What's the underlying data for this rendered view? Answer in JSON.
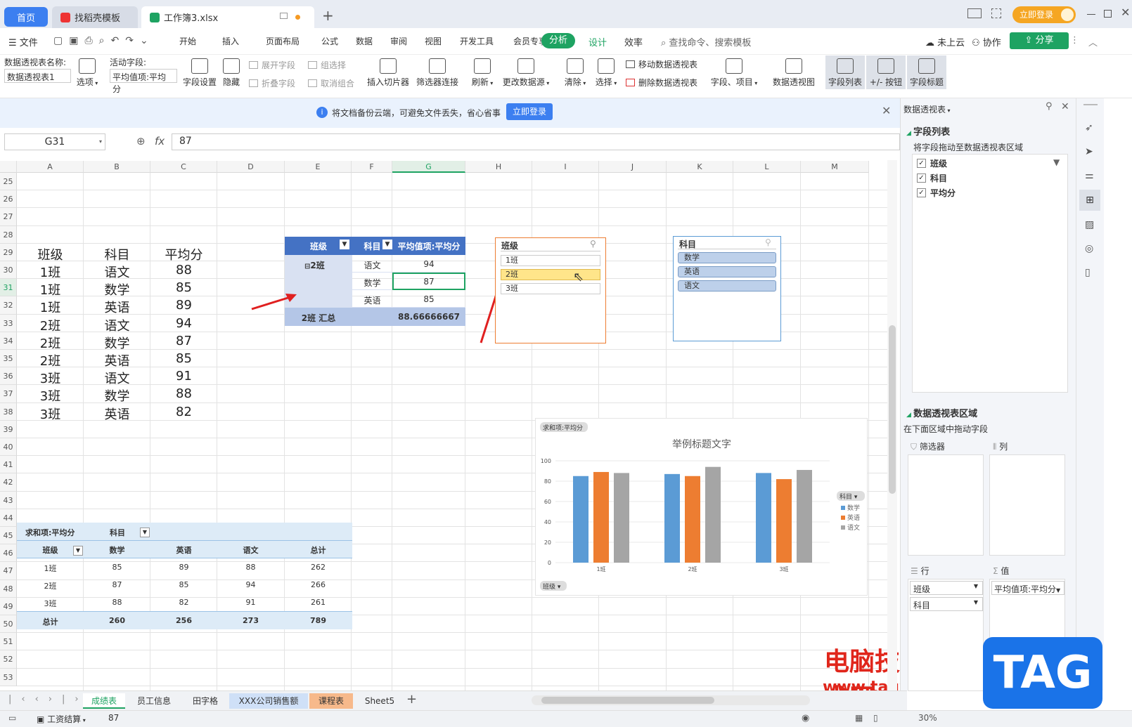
{
  "tabs": {
    "home": "首页",
    "docer": "找稻壳模板",
    "file": "工作簿3.xlsx",
    "login": "立即登录"
  },
  "menu": {
    "file": "文件",
    "items": [
      "开始",
      "插入",
      "页面布局",
      "公式",
      "数据",
      "审阅",
      "视图",
      "开发工具",
      "会员专享"
    ],
    "active": "分析",
    "design": "设计",
    "efficiency": "效率",
    "search": "查找命令、搜索模板",
    "cloud": "未上云",
    "collab": "协作",
    "share": "分享"
  },
  "ribbon": {
    "pt_name_label": "数据透视表名称:",
    "pt_name_value": "数据透视表1",
    "options": "选项",
    "active_field_label": "活动字段:",
    "active_field_value": "平均值项:平均分",
    "field_settings": "字段设置",
    "hide": "隐藏",
    "expand": "展开字段",
    "collapse": "折叠字段",
    "group_sel": "组选择",
    "ungroup": "取消组合",
    "insert_slicer": "插入切片器",
    "filter_conn": "筛选器连接",
    "refresh": "刷新",
    "change_source": "更改数据源",
    "clear": "清除",
    "select": "选择",
    "move_pt": "移动数据透视表",
    "delete_pt": "删除数据透视表",
    "fields_items": "字段、项目",
    "pt_view": "数据透视图",
    "field_list": "字段列表",
    "pm_button": "+/- 按钮",
    "field_header": "字段标题"
  },
  "notice": {
    "text": "将文档备份云端，可避免文件丢失，省心省事",
    "button": "立即登录"
  },
  "formula": {
    "cell": "G31",
    "fx": "fx",
    "value": "87"
  },
  "columns": [
    "A",
    "B",
    "C",
    "D",
    "E",
    "F",
    "G",
    "H",
    "I",
    "J",
    "K",
    "L",
    "M"
  ],
  "rows": [
    "25",
    "26",
    "27",
    "28",
    "29",
    "30",
    "31",
    "32",
    "33",
    "34",
    "35",
    "36",
    "37",
    "38",
    "39",
    "40",
    "41",
    "42",
    "43",
    "44",
    "45",
    "46",
    "47",
    "48",
    "49",
    "50",
    "51",
    "52",
    "53"
  ],
  "source_table": {
    "headers": [
      "班级",
      "科目",
      "平均分"
    ],
    "rows": [
      [
        "1班",
        "语文",
        "88"
      ],
      [
        "1班",
        "数学",
        "85"
      ],
      [
        "1班",
        "英语",
        "89"
      ],
      [
        "2班",
        "语文",
        "94"
      ],
      [
        "2班",
        "数学",
        "87"
      ],
      [
        "2班",
        "英语",
        "85"
      ],
      [
        "3班",
        "语文",
        "91"
      ],
      [
        "3班",
        "数学",
        "88"
      ],
      [
        "3班",
        "英语",
        "82"
      ]
    ]
  },
  "pivot1": {
    "h_class": "班级",
    "h_subject": "科目",
    "h_value": "平均值项:平均分",
    "group": "2班",
    "rows": [
      [
        "语文",
        "94"
      ],
      [
        "数学",
        "87"
      ],
      [
        "英语",
        "85"
      ]
    ],
    "total_label": "2班 汇总",
    "total_value": "88.66666667"
  },
  "slicer_class": {
    "title": "班级",
    "items": [
      "1班",
      "2班",
      "3班"
    ]
  },
  "slicer_subject": {
    "title": "科目",
    "items": [
      "数学",
      "英语",
      "语文"
    ]
  },
  "pivot2": {
    "title": "求和项:平均分",
    "col_field": "科目",
    "row_field": "班级",
    "cols": [
      "数学",
      "英语",
      "语文",
      "总计"
    ],
    "rows": [
      [
        "1班",
        "85",
        "89",
        "88",
        "262"
      ],
      [
        "2班",
        "87",
        "85",
        "94",
        "266"
      ],
      [
        "3班",
        "88",
        "82",
        "91",
        "261"
      ]
    ],
    "total": [
      "总计",
      "260",
      "256",
      "273",
      "789"
    ]
  },
  "chart_data": {
    "type": "bar",
    "field_button": "求和项:平均分",
    "title": "举例标题文字",
    "categories": [
      "1班",
      "2班",
      "3班"
    ],
    "series": [
      {
        "name": "数学",
        "values": [
          85,
          87,
          88
        ],
        "color": "#5b9bd5"
      },
      {
        "name": "英语",
        "values": [
          89,
          85,
          82
        ],
        "color": "#ed7d31"
      },
      {
        "name": "语文",
        "values": [
          88,
          94,
          91
        ],
        "color": "#a5a5a5"
      }
    ],
    "ylim": [
      0,
      100
    ],
    "yticks": [
      "100",
      "80",
      "60",
      "40",
      "20",
      "0"
    ],
    "legend_title": "科目",
    "axis_button": "班级"
  },
  "right_panel": {
    "title": "数据透视表",
    "field_list": "字段列表",
    "drag_hint": "将字段拖动至数据透视表区域",
    "fields": [
      "班级",
      "科目",
      "平均分"
    ],
    "area_title": "数据透视表区域",
    "area_hint": "在下面区域中拖动字段",
    "filter": "筛选器",
    "col": "列",
    "row": "行",
    "value": "值",
    "row_items": [
      "班级",
      "科目"
    ],
    "value_items": [
      "平均值项:平均分"
    ]
  },
  "sheets": [
    "成绩表",
    "员工信息",
    "田字格",
    "XXX公司销售额",
    "课程表",
    "Sheet5"
  ],
  "status": {
    "name": "工资结算",
    "value": "87",
    "zoom": "30%"
  },
  "watermark": {
    "cn": "电脑技术网",
    "url": "www.tagxp.com",
    "tag": "TAG"
  }
}
